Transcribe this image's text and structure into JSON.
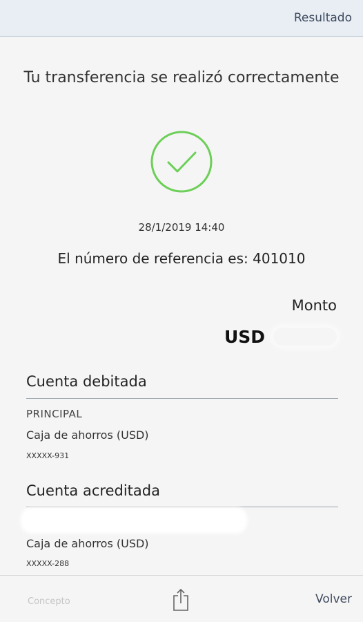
{
  "header": {
    "title": "Resultado"
  },
  "result": {
    "headline": "Tu transferencia se realizó correctamente",
    "status_icon": "check-circle-icon",
    "date": "28/1/2019 14:40",
    "reference_text": "El número de referencia es: 401010"
  },
  "amount": {
    "label": "Monto",
    "currency": "USD"
  },
  "debited": {
    "title": "Cuenta debitada",
    "alias": "PRINCIPAL",
    "type": "Caja de ahorros (USD)",
    "number": "XXXXX-931"
  },
  "credited": {
    "title": "Cuenta acreditada",
    "type": "Caja de ahorros (USD)",
    "number": "XXXXX-288"
  },
  "footer": {
    "concept_label": "Concepto",
    "share_icon": "share-icon",
    "back_label": "Volver"
  },
  "colors": {
    "success": "#6ccf57",
    "header_bg": "#e9eef4",
    "link": "#3e4a5e"
  }
}
